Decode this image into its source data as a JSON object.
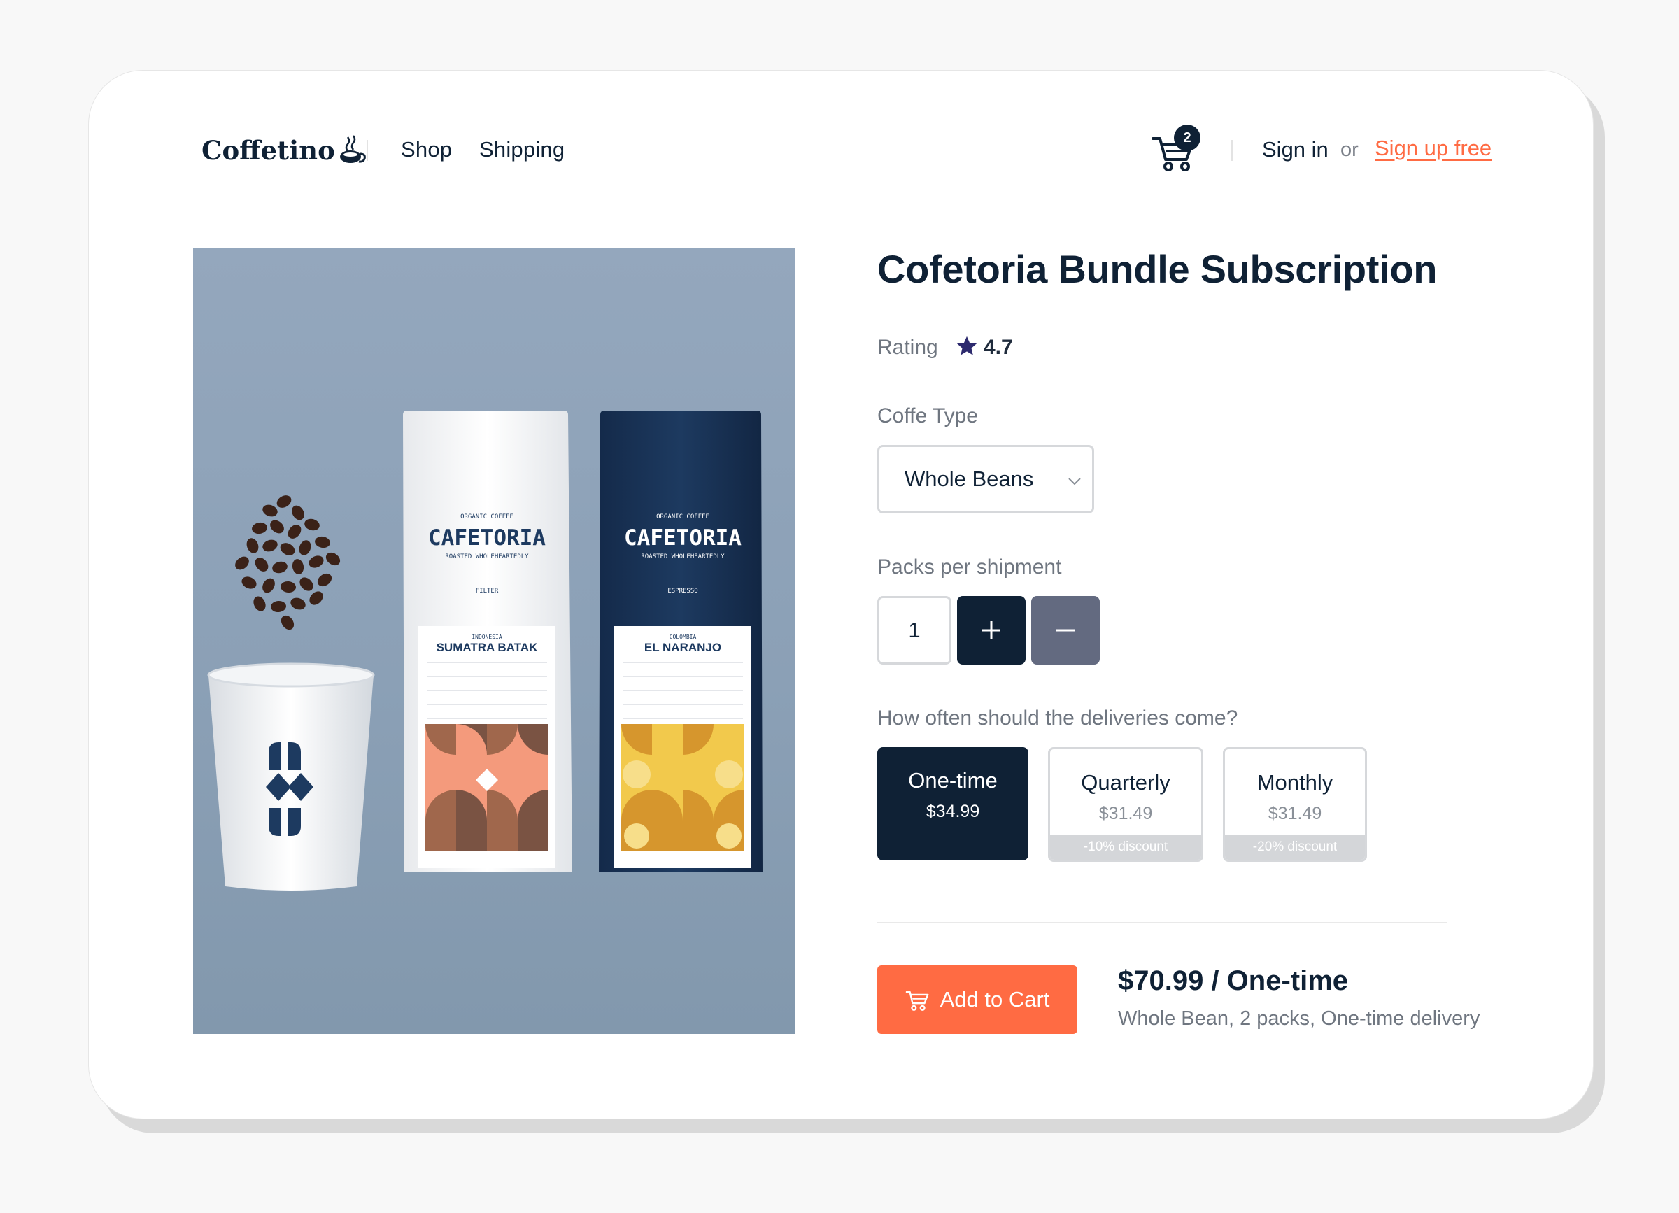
{
  "header": {
    "logo": "Coffetino",
    "nav": [
      "Shop",
      "Shipping"
    ],
    "cart_count": "2",
    "sign_in": "Sign in",
    "or": "or",
    "sign_up": "Sign up free"
  },
  "product_image": {
    "bag1": {
      "subtitle": "ORGANIC COFFEE",
      "brand": "CAFETORIA",
      "tagline": "ROASTED WHOLEHEARTEDLY",
      "style": "FILTER",
      "origin": "INDONESIA",
      "name": "SUMATRA BATAK"
    },
    "bag2": {
      "subtitle": "ORGANIC COFFEE",
      "brand": "CAFETORIA",
      "tagline": "ROASTED WHOLEHEARTEDLY",
      "style": "ESPRESSO",
      "origin": "COLOMBIA",
      "name": "EL NARANJO"
    }
  },
  "product": {
    "title": "Cofetoria Bundle Subscription",
    "rating_label": "Rating",
    "rating_value": "4.7",
    "coffee_type_label": "Coffe Type",
    "coffee_type_value": "Whole Beans",
    "packs_label": "Packs per shipment",
    "packs_value": "1",
    "frequency_label": "How often should the deliveries come?",
    "frequency_options": [
      {
        "name": "One-time",
        "price": "$34.99",
        "discount": "",
        "selected": true
      },
      {
        "name": "Quarterly",
        "price": "$31.49",
        "discount": "-10% discount",
        "selected": false
      },
      {
        "name": "Monthly",
        "price": "$31.49",
        "discount": "-20% discount",
        "selected": false
      }
    ],
    "add_to_cart": "Add to Cart",
    "summary_price": "$70.99 / One-time",
    "summary_detail": "Whole Bean, 2 packs,  One-time delivery"
  },
  "colors": {
    "navy": "#0f2135",
    "accent": "#ff6b43",
    "slate": "#636a80",
    "star": "#2d2a6e"
  }
}
